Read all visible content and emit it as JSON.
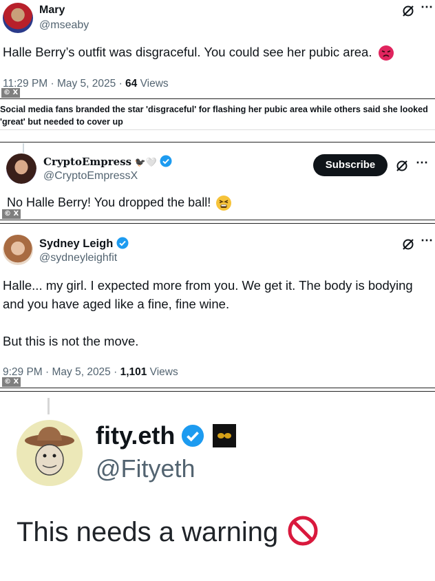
{
  "tweet1": {
    "name": "Mary",
    "handle": "@mseaby",
    "text": "Halle Berry’s outfit was disgraceful.  You could see her pubic area.",
    "time": "11:29 PM · May 5, 2025 · ",
    "views_count": "64",
    "views_label": " Views",
    "credit": "© X"
  },
  "caption": "Social media fans branded the star 'disgraceful' for flashing her pubic area while others said she looked 'great' but needed to cover up",
  "tweet2": {
    "name": "𝐂𝐫𝐲𝐩𝐭𝐨𝐄𝐦𝐩𝐫𝐞𝐬𝐬",
    "name_deco": "🐦‍⬛🤍",
    "handle": "@CryptoEmpressX",
    "subscribe": "Subscribe",
    "text": "No Halle Berry! You dropped the ball!",
    "credit": "© X"
  },
  "tweet3": {
    "name": "Sydney Leigh",
    "handle": "@sydneyleighfit",
    "text1": "Halle... my girl. I expected more from you. We get it. The body is bodying",
    "text2": "and you have aged like a fine, fine wine.",
    "text3": "But this is not the move.",
    "time": "9:29 PM · May 5, 2025 · ",
    "views_count": "1,101",
    "views_label": " Views",
    "credit": "© X"
  },
  "tweet4": {
    "name": "fity.eth",
    "handle": "@Fityeth",
    "text": "This needs a warning"
  },
  "colors": {
    "verified": "#1d9bf0",
    "subscribe_bg": "#0f1419",
    "angry": "#e0245e",
    "no_symbol": "#d9193d"
  }
}
